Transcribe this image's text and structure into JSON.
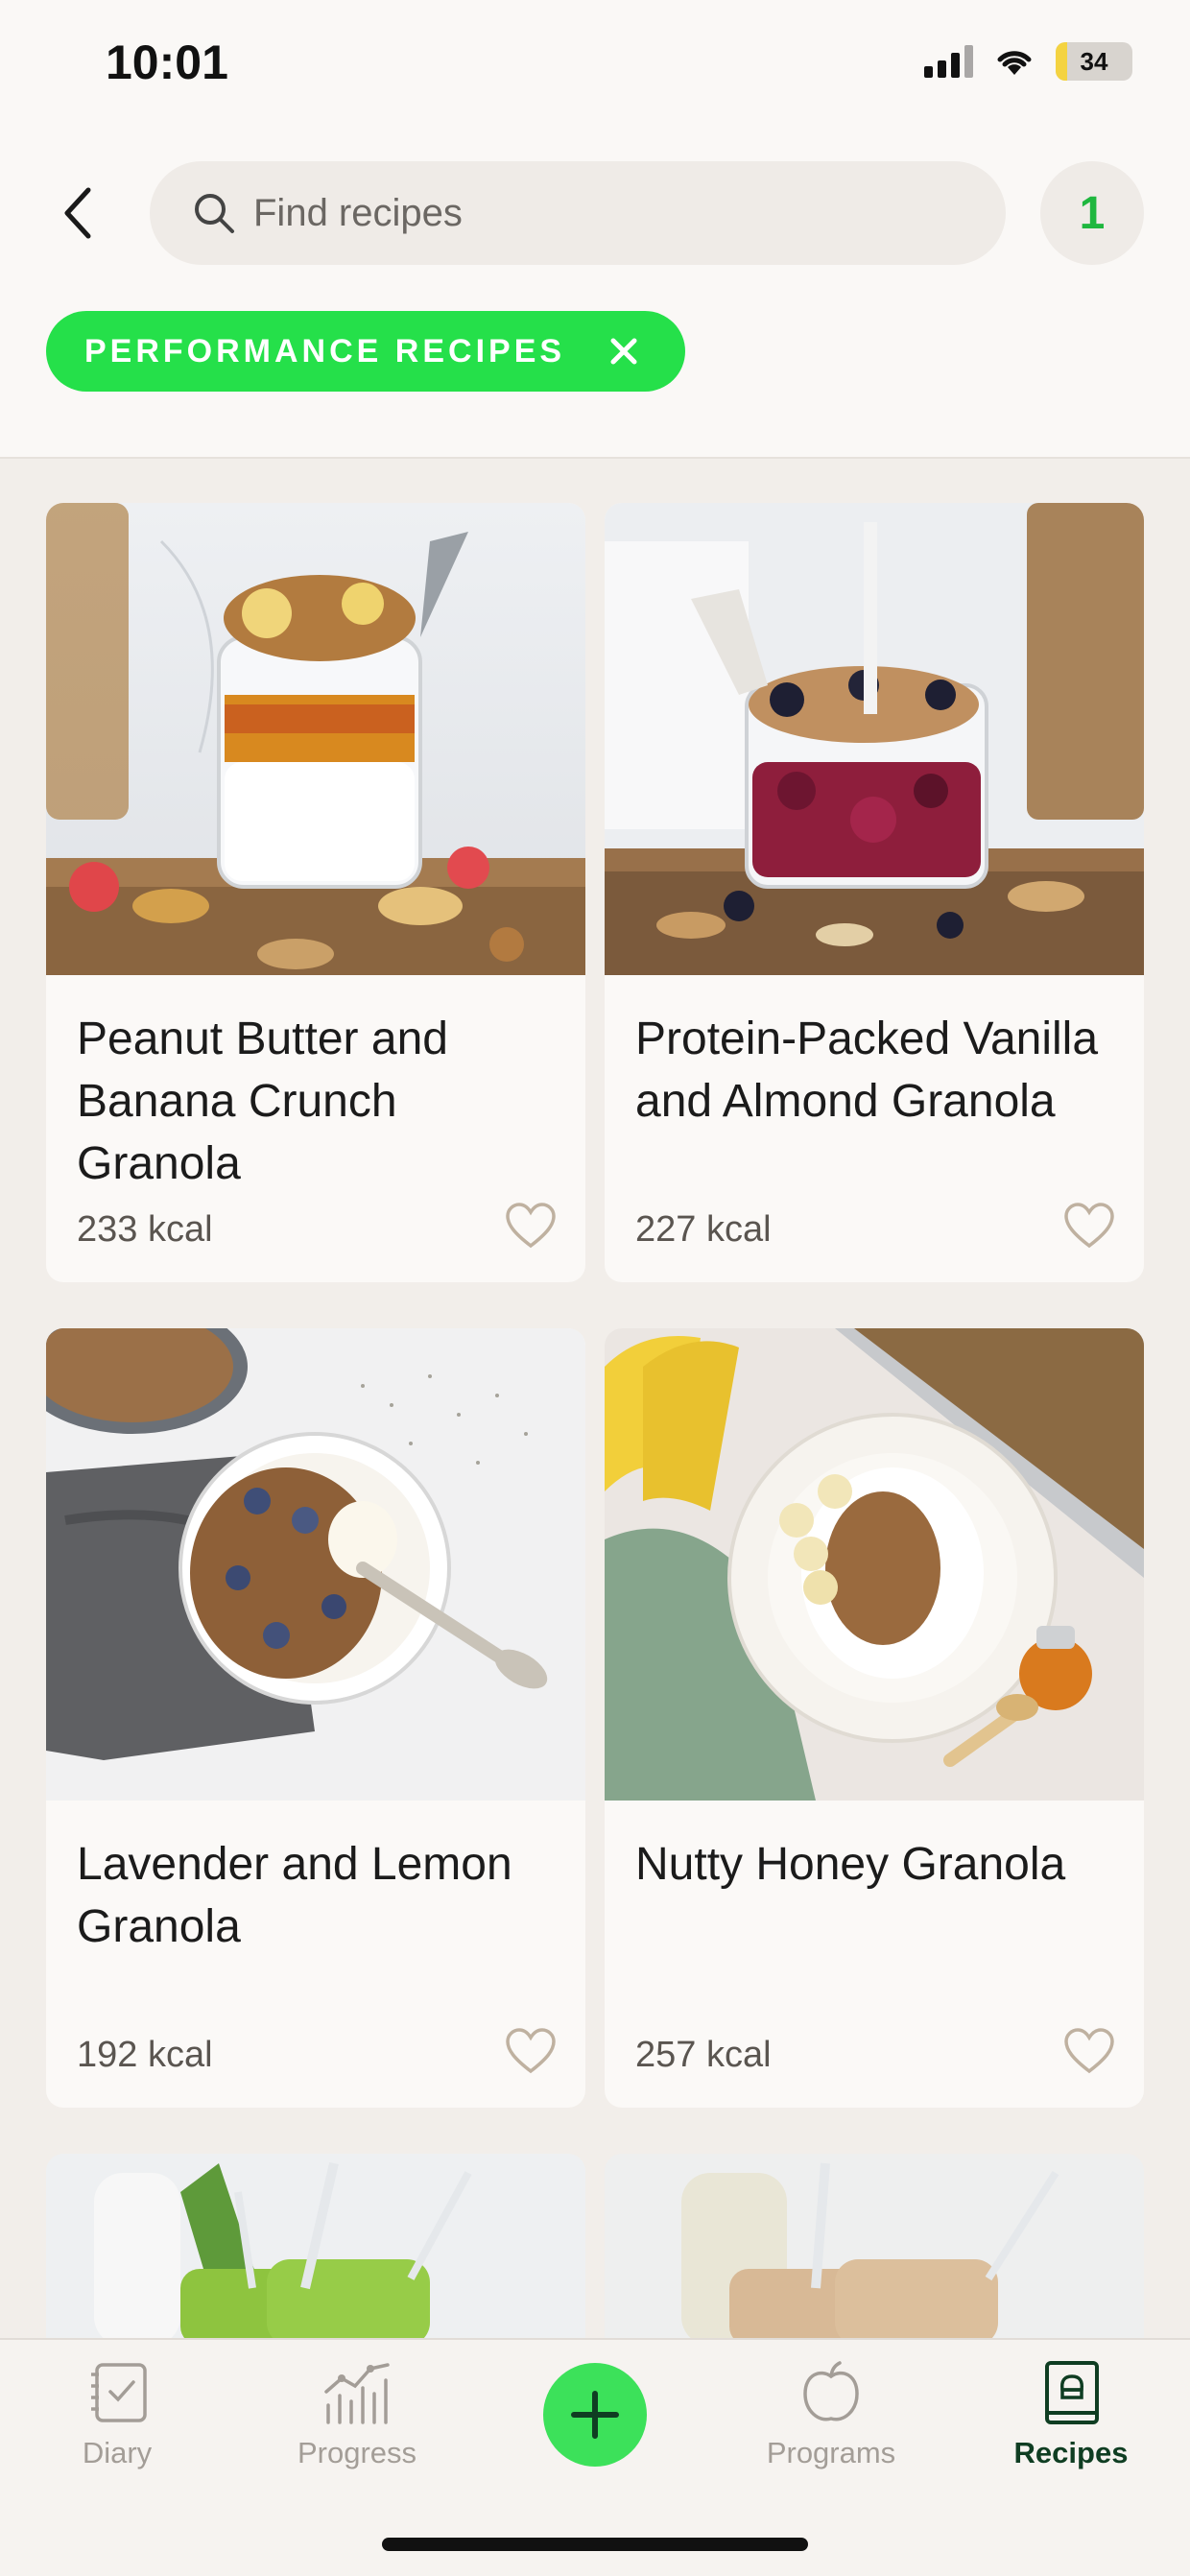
{
  "status_bar": {
    "time": "10:01",
    "battery": "34"
  },
  "header": {
    "search_placeholder": "Find recipes",
    "count": "1",
    "filter_chip": "PERFORMANCE RECIPES"
  },
  "recipes": [
    {
      "title": "Peanut Butter and Banana Crunch Granola",
      "kcal": "233 kcal"
    },
    {
      "title": "Protein-Packed Vanilla and Almond Granola",
      "kcal": "227 kcal"
    },
    {
      "title": "Lavender and Lemon Granola",
      "kcal": "192 kcal"
    },
    {
      "title": "Nutty Honey Granola",
      "kcal": "257 kcal"
    }
  ],
  "tabs": [
    {
      "label": "Diary"
    },
    {
      "label": "Progress"
    },
    {
      "label": "Programs"
    },
    {
      "label": "Recipes"
    }
  ],
  "colors": {
    "accent_green": "#25e04a",
    "active_tab": "#0f3d22",
    "count_green": "#1fb73f"
  }
}
